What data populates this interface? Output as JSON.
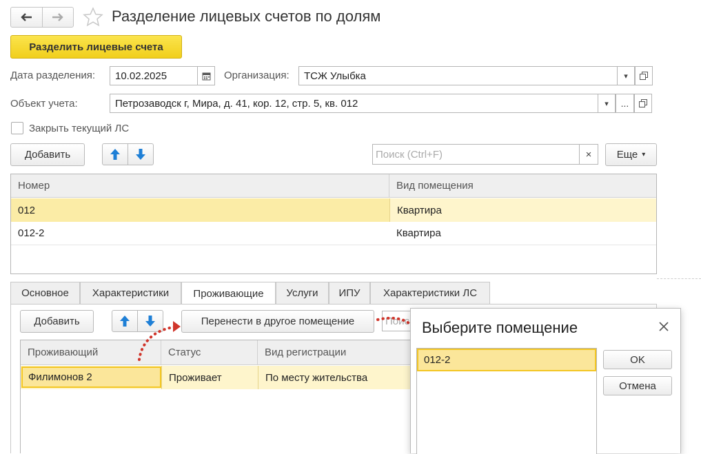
{
  "window": {
    "title": "Разделение лицевых счетов по долям",
    "main_action": "Разделить лицевые счета"
  },
  "form": {
    "date_label": "Дата разделения:",
    "date_value": "10.02.2025",
    "org_label": "Организация:",
    "org_value": "ТСЖ Улыбка",
    "object_label": "Объект учета:",
    "object_value": "Петрозаводск г, Мира, д. 41, кор. 12, стр. 5, кв. 012",
    "close_checkbox_label": "Закрыть текущий ЛС",
    "dots": "..."
  },
  "toolbar": {
    "add_label": "Добавить",
    "search_placeholder": "Поиск (Ctrl+F)",
    "more_label": "Еще"
  },
  "accounts_table": {
    "columns": [
      "Номер",
      "Вид помещения"
    ],
    "rows": [
      {
        "number": "012",
        "type": "Квартира"
      },
      {
        "number": "012-2",
        "type": "Квартира"
      }
    ]
  },
  "tabs": [
    "Основное",
    "Характеристики",
    "Проживающие",
    "Услуги",
    "ИПУ",
    "Характеристики ЛС"
  ],
  "residents": {
    "add_label": "Добавить",
    "move_label": "Перенести в другое помещение",
    "search_placeholder": "Поис",
    "columns": [
      "Проживающий",
      "Статус",
      "Вид регистрации"
    ],
    "rows": [
      {
        "name": "Филимонов 2",
        "status": "Проживает",
        "registration": "По месту жительства"
      }
    ]
  },
  "dialog": {
    "title": "Выберите помещение",
    "items": [
      "012-2"
    ],
    "ok_label": "OK",
    "cancel_label": "Отмена"
  },
  "colors": {
    "accent_yellow": "#f5d932",
    "selected_row": "#fbeca6",
    "arrow_blue": "#1e7fd6",
    "annotation_red": "#d0352b"
  }
}
